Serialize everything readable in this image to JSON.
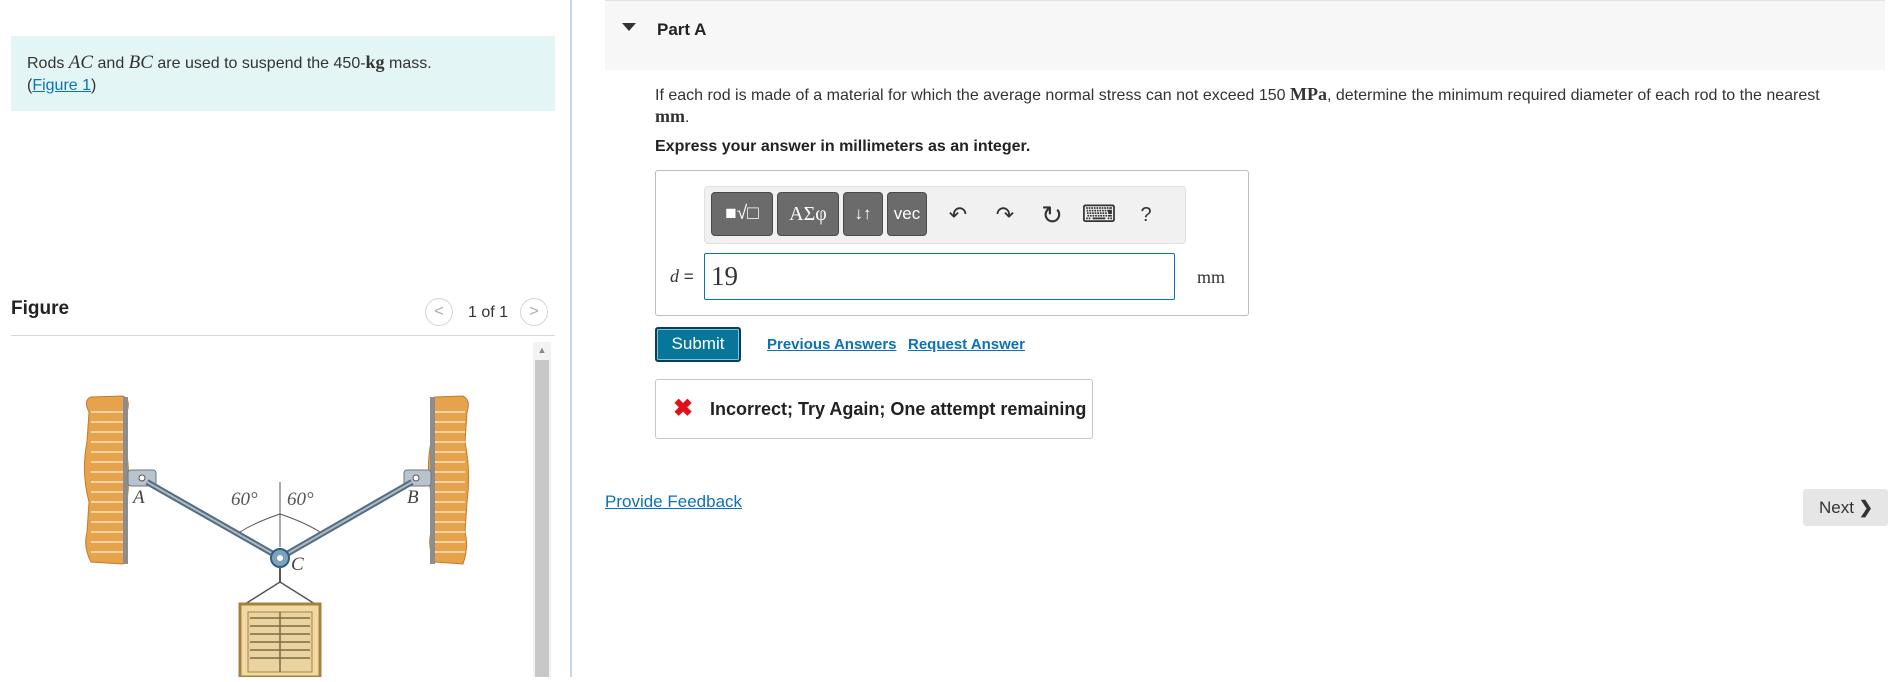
{
  "problem": {
    "text_prefix": "Rods ",
    "rod1": "AC",
    "text_and": " and ",
    "rod2": "BC",
    "text_mid": " are used to suspend the 450-",
    "mass_unit": "kg",
    "text_end": " mass.",
    "figure_link_open": "(",
    "figure_link": "Figure 1",
    "figure_link_close": ")"
  },
  "figure_panel": {
    "title": "Figure",
    "prev": "<",
    "next": ">",
    "counter": "1 of 1",
    "labels": {
      "A": "A",
      "B": "B",
      "C": "C",
      "angle_left": "60°",
      "angle_right": "60°"
    }
  },
  "part": {
    "title": "Part A",
    "question_prefix": "If each rod is made of a material for which the average normal stress can not exceed 150 ",
    "stress_unit": "MPa",
    "question_suffix": ", determine the minimum required diameter of each rod to the nearest ",
    "length_unit": "mm",
    "question_end": ".",
    "instruction": "Express your answer in millimeters as an integer."
  },
  "toolbar": {
    "templates": "■√□",
    "greek": "ΑΣφ",
    "arrows": "↓↑",
    "vec": "vec",
    "undo": "↶",
    "redo": "↷",
    "reset": "↻",
    "keyboard": "⌨",
    "help": "?"
  },
  "answer": {
    "label_var": "d",
    "label_eq": " =",
    "value": "19",
    "unit": "mm"
  },
  "actions": {
    "submit": "Submit",
    "previous_answers": "Previous Answers",
    "request_answer": "Request Answer"
  },
  "feedback": {
    "icon": "✖",
    "message": "Incorrect; Try Again; One attempt remaining"
  },
  "footer": {
    "provide_feedback": "Provide Feedback",
    "next": "Next",
    "next_icon": "❯"
  },
  "colors": {
    "problem_bg": "#e4f5f6",
    "link": "#0b72b5",
    "submit_bg": "#08769b",
    "error_red": "#e0111d",
    "toolbar_button": "#6b6b6b"
  }
}
